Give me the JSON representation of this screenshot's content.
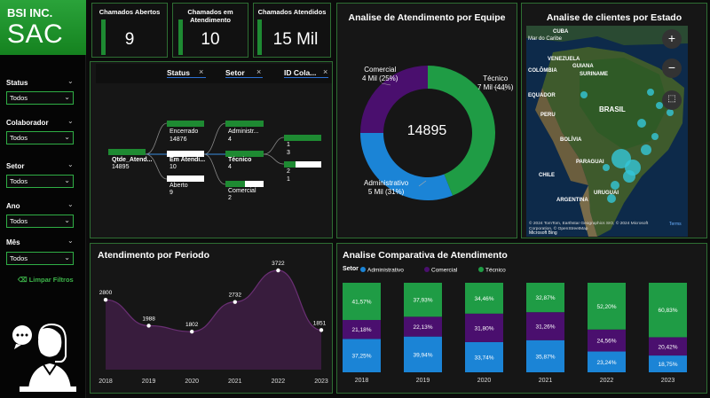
{
  "brand": {
    "company": "BSI INC.",
    "product": "SAC"
  },
  "filters": [
    {
      "label": "Status",
      "value": "Todos"
    },
    {
      "label": "Colaborador",
      "value": "Todos"
    },
    {
      "label": "Setor",
      "value": "Todos"
    },
    {
      "label": "Ano",
      "value": "Todos"
    },
    {
      "label": "Mês",
      "value": "Todos"
    }
  ],
  "clear_filters": "Limpar Filtros",
  "kpis": [
    {
      "title": "Chamados Abertos",
      "value": "9"
    },
    {
      "title": "Chamados em Atendimento",
      "value": "10"
    },
    {
      "title": "Chamados Atendidos",
      "value": "15 Mil"
    }
  ],
  "decomp_tree": {
    "headers": [
      "Status",
      "Setor",
      "ID Cola..."
    ],
    "root": {
      "label": "Qtde_Atend...",
      "value": "14895"
    },
    "status": [
      {
        "label": "Encerrado",
        "value": "14876"
      },
      {
        "label": "Em Atendi...",
        "value": "10"
      },
      {
        "label": "Aberto",
        "value": "9"
      }
    ],
    "setor": [
      {
        "label": "Administr...",
        "value": "4"
      },
      {
        "label": "Técnico",
        "value": "4"
      },
      {
        "label": "Comercial",
        "value": "2"
      }
    ],
    "ids": [
      {
        "label": "1",
        "value": "3"
      },
      {
        "label": "2",
        "value": "1"
      }
    ]
  },
  "donut": {
    "title": "Analise de Atendimento por Equipe",
    "center": "14895",
    "labels": [
      {
        "name": "Técnico",
        "value": "7 Mil (44%)"
      },
      {
        "name": "Administrativo",
        "value": "5 Mil (31%)"
      },
      {
        "name": "Comercial",
        "value": "4 Mil (25%)"
      }
    ]
  },
  "map": {
    "title": "Analise de clientes por Estado",
    "labels": [
      "Mar do Caribe",
      "CUBA",
      "VENEZUELA",
      "COLÔMBIA",
      "GUIANA",
      "SURINAME",
      "EQUADOR",
      "BRASIL",
      "PERU",
      "BOLÍVIA",
      "PARAGUAI",
      "CHILE",
      "URUGUAI",
      "ARGENTINA"
    ],
    "attribution": "© 2024 TomTom, Earthstar Geographics SIO, © 2024 Microsoft Corporation, © OpenStreetMap",
    "terms": "Terms",
    "logo": "Microsoft Bing"
  },
  "period": {
    "title": "Atendimento por Periodo"
  },
  "comparative": {
    "title": "Analise Comparativa de Atendimento",
    "legend_title": "Setor"
  },
  "colors": {
    "green": "#1e8a32",
    "tecnico": "#1f9c45",
    "administrativo": "#1b84d6",
    "comercial": "#4a0f6e",
    "panel_border": "#2e6e33"
  },
  "chart_data": [
    {
      "type": "area",
      "title": "Atendimento por Periodo",
      "categories": [
        "2018",
        "2019",
        "2020",
        "2021",
        "2022",
        "2023"
      ],
      "values": [
        2800,
        1988,
        1802,
        2732,
        3722,
        1851
      ]
    },
    {
      "type": "bar",
      "title": "Analise Comparativa de Atendimento",
      "categories": [
        "2018",
        "2019",
        "2020",
        "2021",
        "2022",
        "2023"
      ],
      "series": [
        {
          "name": "Administrativo",
          "values": [
            37.25,
            39.94,
            33.74,
            35.87,
            23.24,
            18.75
          ],
          "labels": [
            "37,25%",
            "39,94%",
            "33,74%",
            "35,87%",
            "23,24%",
            "18,75%"
          ]
        },
        {
          "name": "Comercial",
          "values": [
            21.18,
            22.13,
            31.8,
            31.26,
            24.56,
            20.42
          ],
          "labels": [
            "21,18%",
            "22,13%",
            "31,80%",
            "31,26%",
            "24,56%",
            "20,42%"
          ]
        },
        {
          "name": "Técnico",
          "values": [
            41.57,
            37.93,
            34.46,
            32.87,
            52.2,
            60.83
          ],
          "labels": [
            "41,57%",
            "37,93%",
            "34,46%",
            "32,87%",
            "52,20%",
            "60,83%"
          ]
        }
      ]
    },
    {
      "type": "pie",
      "title": "Analise de Atendimento por Equipe",
      "categories": [
        "Técnico",
        "Administrativo",
        "Comercial"
      ],
      "values": [
        44,
        31,
        25
      ]
    }
  ]
}
